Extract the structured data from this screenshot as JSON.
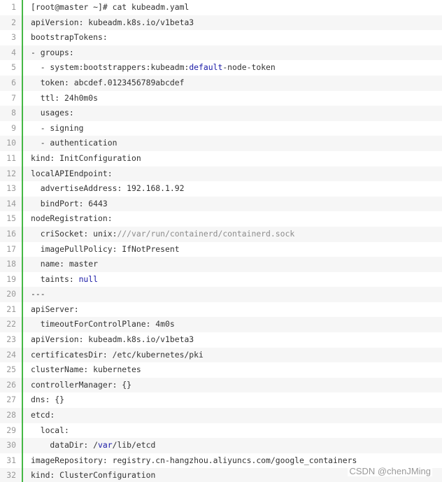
{
  "code": {
    "lines": [
      {
        "n": "1",
        "segs": [
          {
            "t": "[root@master ~]# cat kubeadm.yaml",
            "c": ""
          }
        ]
      },
      {
        "n": "2",
        "segs": [
          {
            "t": "apiVersion: kubeadm.k8s.io/v1beta3",
            "c": ""
          }
        ]
      },
      {
        "n": "3",
        "segs": [
          {
            "t": "bootstrapTokens:",
            "c": ""
          }
        ]
      },
      {
        "n": "4",
        "segs": [
          {
            "t": "- groups:",
            "c": ""
          }
        ]
      },
      {
        "n": "5",
        "segs": [
          {
            "t": "  - system:bootstrappers:kubeadm:",
            "c": ""
          },
          {
            "t": "default",
            "c": "kw"
          },
          {
            "t": "-node-token",
            "c": ""
          }
        ]
      },
      {
        "n": "6",
        "segs": [
          {
            "t": "  token: abcdef.0123456789abcdef",
            "c": ""
          }
        ]
      },
      {
        "n": "7",
        "segs": [
          {
            "t": "  ttl: 24h0m0s",
            "c": ""
          }
        ]
      },
      {
        "n": "8",
        "segs": [
          {
            "t": "  usages:",
            "c": ""
          }
        ]
      },
      {
        "n": "9",
        "segs": [
          {
            "t": "  - signing",
            "c": ""
          }
        ]
      },
      {
        "n": "10",
        "segs": [
          {
            "t": "  - authentication",
            "c": ""
          }
        ]
      },
      {
        "n": "11",
        "segs": [
          {
            "t": "kind: InitConfiguration",
            "c": ""
          }
        ]
      },
      {
        "n": "12",
        "segs": [
          {
            "t": "localAPIEndpoint:",
            "c": ""
          }
        ]
      },
      {
        "n": "13",
        "segs": [
          {
            "t": "  advertiseAddress: 192.168.1.92",
            "c": ""
          }
        ]
      },
      {
        "n": "14",
        "segs": [
          {
            "t": "  bindPort: 6443",
            "c": ""
          }
        ]
      },
      {
        "n": "15",
        "segs": [
          {
            "t": "nodeRegistration:",
            "c": ""
          }
        ]
      },
      {
        "n": "16",
        "segs": [
          {
            "t": "  criSocket: unix:",
            "c": ""
          },
          {
            "t": "///var/run/containerd/containerd.sock",
            "c": "comment"
          }
        ]
      },
      {
        "n": "17",
        "segs": [
          {
            "t": "  imagePullPolicy: IfNotPresent",
            "c": ""
          }
        ]
      },
      {
        "n": "18",
        "segs": [
          {
            "t": "  name: master",
            "c": ""
          }
        ]
      },
      {
        "n": "19",
        "segs": [
          {
            "t": "  taints: ",
            "c": ""
          },
          {
            "t": "null",
            "c": "kw"
          }
        ]
      },
      {
        "n": "20",
        "segs": [
          {
            "t": "---",
            "c": ""
          }
        ]
      },
      {
        "n": "21",
        "segs": [
          {
            "t": "apiServer:",
            "c": ""
          }
        ]
      },
      {
        "n": "22",
        "segs": [
          {
            "t": "  timeoutForControlPlane: 4m0s",
            "c": ""
          }
        ]
      },
      {
        "n": "23",
        "segs": [
          {
            "t": "apiVersion: kubeadm.k8s.io/v1beta3",
            "c": ""
          }
        ]
      },
      {
        "n": "24",
        "segs": [
          {
            "t": "certificatesDir: /etc/kubernetes/pki",
            "c": ""
          }
        ]
      },
      {
        "n": "25",
        "segs": [
          {
            "t": "clusterName: kubernetes",
            "c": ""
          }
        ]
      },
      {
        "n": "26",
        "segs": [
          {
            "t": "controllerManager: {}",
            "c": ""
          }
        ]
      },
      {
        "n": "27",
        "segs": [
          {
            "t": "dns: {}",
            "c": ""
          }
        ]
      },
      {
        "n": "28",
        "segs": [
          {
            "t": "etcd:",
            "c": ""
          }
        ]
      },
      {
        "n": "29",
        "segs": [
          {
            "t": "  local:",
            "c": ""
          }
        ]
      },
      {
        "n": "30",
        "segs": [
          {
            "t": "    dataDir: /",
            "c": ""
          },
          {
            "t": "var",
            "c": "kw"
          },
          {
            "t": "/lib/etcd",
            "c": ""
          }
        ]
      },
      {
        "n": "31",
        "segs": [
          {
            "t": "imageRepository: registry.cn-hangzhou.aliyuncs.com/google_containers",
            "c": ""
          }
        ]
      },
      {
        "n": "32",
        "segs": [
          {
            "t": "kind: ClusterConfiguration",
            "c": ""
          }
        ]
      }
    ]
  },
  "watermark": "CSDN @chenJMing",
  "colors": {
    "keyword": "#1a1aa6",
    "comment": "#8c8c8c",
    "gutter_border": "#45b845",
    "alt_row": "#f6f6f6"
  }
}
